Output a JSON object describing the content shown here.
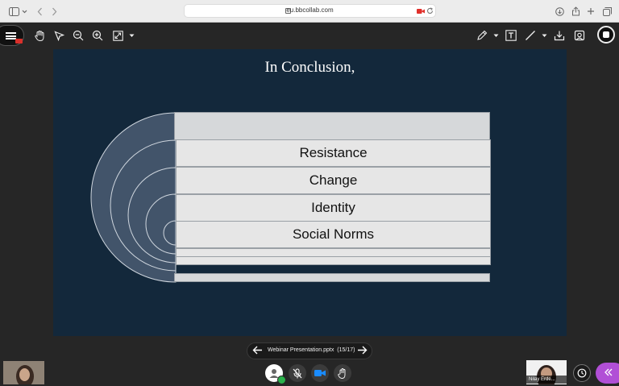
{
  "browser": {
    "url": "eu.bbcollab.com",
    "icons": [
      "sidebar-icon",
      "chevron-down-icon",
      "back-icon",
      "forward-icon",
      "lock-icon",
      "camera-icon",
      "reload-icon",
      "download-icon",
      "share-icon",
      "new-tab-icon",
      "tabs-icon"
    ]
  },
  "toolbar": {
    "left_tools": [
      "menu-icon",
      "pan-hand-icon",
      "pointer-icon",
      "zoom-out-icon",
      "zoom-in-icon",
      "fit-screen-icon",
      "chevron-down-icon"
    ],
    "right_tools": [
      "pen-icon",
      "chevron-down-icon",
      "text-icon",
      "line-icon",
      "chevron-down-icon",
      "download-icon",
      "clear-icon",
      "stop-share-icon"
    ]
  },
  "slide": {
    "title": "In Conclusion,",
    "bars": [
      "",
      "Resistance",
      "Change",
      "Identity",
      "Social Norms",
      "",
      "",
      ""
    ],
    "colors": {
      "background": "#13283b",
      "bar": "#e6e6e6",
      "arc": "#42546a"
    }
  },
  "presentation": {
    "file_label": "Webinar Presentation.pptx",
    "page_label": "(15/17)"
  },
  "participants": {
    "presenter_name": "Nilay Erde..."
  },
  "controls": [
    "profile-icon",
    "mic-muted-icon",
    "camera-icon",
    "hand-raise-icon",
    "activity-icon",
    "collapse-panel-icon"
  ],
  "colors": {
    "accent": "#b14fd6",
    "camera_on": "#1a8cff",
    "status_ok": "#2bb24c",
    "record": "#d9302b"
  }
}
